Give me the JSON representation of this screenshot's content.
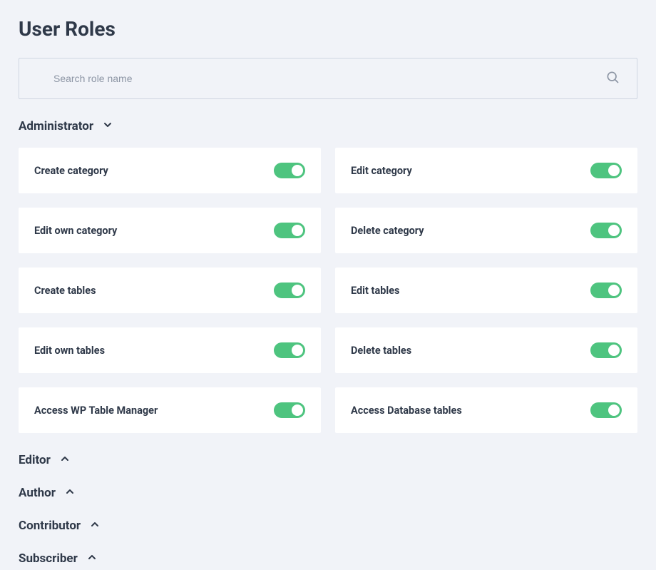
{
  "page_title": "User Roles",
  "search": {
    "placeholder": "Search role name",
    "value": ""
  },
  "roles": [
    {
      "name": "Administrator",
      "expanded": true,
      "permissions": [
        {
          "label": "Create category",
          "enabled": true
        },
        {
          "label": "Edit category",
          "enabled": true
        },
        {
          "label": "Edit own category",
          "enabled": true
        },
        {
          "label": "Delete category",
          "enabled": true
        },
        {
          "label": "Create tables",
          "enabled": true
        },
        {
          "label": "Edit tables",
          "enabled": true
        },
        {
          "label": "Edit own tables",
          "enabled": true
        },
        {
          "label": "Delete tables",
          "enabled": true
        },
        {
          "label": "Access WP Table Manager",
          "enabled": true
        },
        {
          "label": "Access Database tables",
          "enabled": true
        }
      ]
    },
    {
      "name": "Editor",
      "expanded": false,
      "permissions": []
    },
    {
      "name": "Author",
      "expanded": false,
      "permissions": []
    },
    {
      "name": "Contributor",
      "expanded": false,
      "permissions": []
    },
    {
      "name": "Subscriber",
      "expanded": false,
      "permissions": []
    }
  ],
  "colors": {
    "toggle_on": "#4ec47f",
    "background": "#f1f3f8",
    "text": "#2f3949",
    "border": "#cfd6e2"
  }
}
